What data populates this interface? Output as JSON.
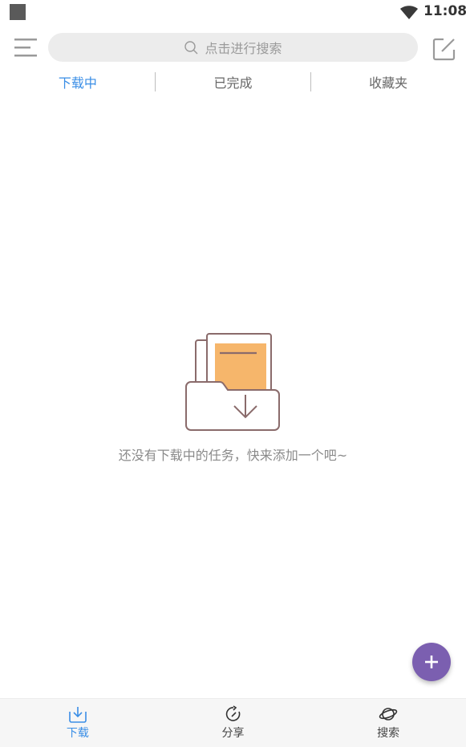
{
  "status_bar": {
    "time": "11:08"
  },
  "search": {
    "placeholder": "点击进行搜索"
  },
  "tabs": [
    {
      "label": "下载中",
      "active": true
    },
    {
      "label": "已完成",
      "active": false
    },
    {
      "label": "收藏夹",
      "active": false
    }
  ],
  "empty_state": {
    "message": "还没有下载中的任务，快来添加一个吧~"
  },
  "bottom_nav": [
    {
      "label": "下载",
      "icon": "download-icon",
      "active": true
    },
    {
      "label": "分享",
      "icon": "share-refresh-icon",
      "active": false
    },
    {
      "label": "搜索",
      "icon": "planet-icon",
      "active": false
    }
  ],
  "colors": {
    "accent": "#3a8ee6",
    "fab": "#7b5fb0",
    "illustration_orange": "#f6b66b"
  }
}
